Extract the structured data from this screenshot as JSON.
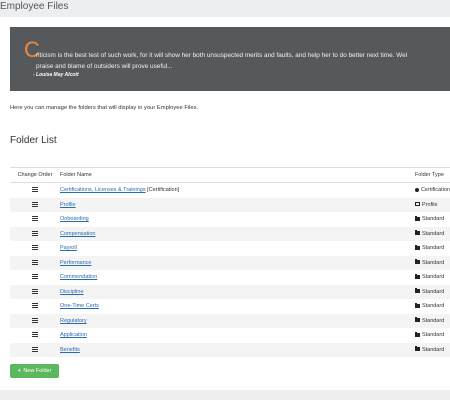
{
  "page": {
    "title": "Employee Files"
  },
  "quote": {
    "first_letter": "C",
    "line1": "riticism is the best test of such work, for it will show her both unsuspected merits and faults, and help her to do better next time. Wel",
    "line2": "praise and blame of outsiders will prove useful...",
    "author": "- Louisa May Alcott"
  },
  "intro_text": "Here you can manage the folders that will display in your Employee Files.",
  "folder_list_title": "Folder List",
  "table": {
    "headers": {
      "order": "Change Order",
      "name": "Folder Name",
      "type": "Folder Type"
    },
    "rows": [
      {
        "name": "Certifications, Licenses & Trainings",
        "suffix": "[Certification]",
        "type": "Certification",
        "icon": "circle-icon"
      },
      {
        "name": "Profile",
        "suffix": "",
        "type": "Profile",
        "icon": "id-card-icon"
      },
      {
        "name": "Onboarding",
        "suffix": "",
        "type": "Standard",
        "icon": "folder-icon"
      },
      {
        "name": "Compensation",
        "suffix": "",
        "type": "Standard",
        "icon": "folder-icon"
      },
      {
        "name": "Payroll",
        "suffix": "",
        "type": "Standard",
        "icon": "folder-icon"
      },
      {
        "name": "Performance",
        "suffix": "",
        "type": "Standard",
        "icon": "folder-icon"
      },
      {
        "name": "Commendation",
        "suffix": "",
        "type": "Standard",
        "icon": "folder-icon"
      },
      {
        "name": "Discipline",
        "suffix": "",
        "type": "Standard",
        "icon": "folder-icon"
      },
      {
        "name": "One-Time Certs",
        "suffix": "",
        "type": "Standard",
        "icon": "folder-icon"
      },
      {
        "name": "Regulatory",
        "suffix": "",
        "type": "Standard",
        "icon": "folder-icon"
      },
      {
        "name": "Application",
        "suffix": "",
        "type": "Standard",
        "icon": "folder-icon"
      },
      {
        "name": "Benefits",
        "suffix": "",
        "type": "Standard",
        "icon": "folder-icon"
      }
    ]
  },
  "new_folder_button": {
    "label": "New Folder",
    "icon": "plus-icon",
    "color": "#5cb85c"
  },
  "colors": {
    "quote_bg": "#55595c",
    "accent": "#f0873a",
    "link": "#2a6bb0"
  }
}
